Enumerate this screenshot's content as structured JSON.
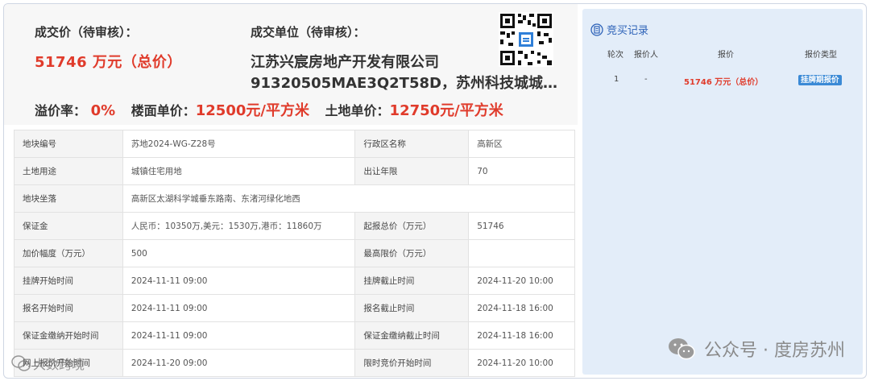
{
  "summary": {
    "price_label": "成交价（待审核）：",
    "price_value": "51746 万元（总价）",
    "unit_label": "成交单位（待审核）：",
    "company_name": "江苏兴宸房地产开发有限公司",
    "company_code": "91320505MAE3Q2T58D，苏州科技城城乡...",
    "premium_label": "溢价率：",
    "premium_value": "0%",
    "floor_price_label": "楼面单价：",
    "floor_price_value": "12500元/平方米",
    "land_price_label": "土地单价：",
    "land_price_value": "12750元/平方米"
  },
  "table": {
    "rows": [
      {
        "k1": "地块编号",
        "v1": "苏地2024-WG-Z28号",
        "k2": "行政区名称",
        "v2": "高新区"
      },
      {
        "k1": "土地用途",
        "v1": "城镇住宅用地",
        "k2": "出让年限",
        "v2": "70"
      },
      {
        "k1": "地块坐落",
        "v1": "高新区太湖科学城垂东路南、东渚河绿化地西"
      },
      {
        "k1": "保证金",
        "v1": "人民币：10350万,美元：1530万,港币：11860万",
        "k2": "起报总价（万元）",
        "v2": "51746"
      },
      {
        "k1": "加价幅度（万元）",
        "v1": "500",
        "k2": "最高限价（万元）",
        "v2": ""
      },
      {
        "k1": "挂牌开始时间",
        "v1": "2024-11-11 09:00",
        "k2": "挂牌截止时间",
        "v2": "2024-11-20 10:00"
      },
      {
        "k1": "报名开始时间",
        "v1": "2024-11-11 09:00",
        "k2": "报名截止时间",
        "v2": "2024-11-18 16:00"
      },
      {
        "k1": "保证金缴纳开始时间",
        "v1": "2024-11-11 09:00",
        "k2": "保证金缴纳截止时间",
        "v2": "2024-11-18 16:00"
      },
      {
        "k1": "网上报价开始时间",
        "v1": "2024-11-20 09:00",
        "k2": "限时竞价开始时间",
        "v2": "2024-11-20 10:00"
      }
    ]
  },
  "bid_record": {
    "title": "竞买记录",
    "headers": [
      "轮次",
      "报价人",
      "报价",
      "报价类型"
    ],
    "rows": [
      {
        "round": "1",
        "bidder": "-",
        "price": "51746 万元（总价）",
        "type": "挂牌期报价"
      }
    ]
  },
  "watermark": {
    "account": "公众号 · 度房苏州",
    "secondary": "大数跨境"
  },
  "colors": {
    "accent_red": "#e03b2b",
    "link_blue": "#2d62b8",
    "panel_bg": "#e3edf9"
  }
}
